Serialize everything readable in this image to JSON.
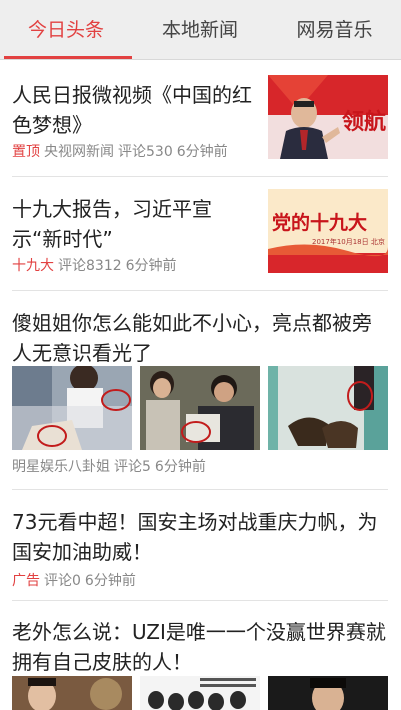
{
  "tabs": [
    {
      "label": "今日头条",
      "active": true
    },
    {
      "label": "本地新闻",
      "active": false
    },
    {
      "label": "网易音乐",
      "active": false
    }
  ],
  "news": [
    {
      "title": "人民日报微视频《中国的红色梦想》",
      "tag": "置顶",
      "source": "央视网新闻",
      "comments": "评论530",
      "time": "6分钟前",
      "thumb_text": "领航"
    },
    {
      "title": "十九大报告，习近平宣示“新时代”",
      "tag": "十九大",
      "source": "",
      "comments": "评论8312",
      "time": "6分钟前",
      "thumb_text": "党的十九大",
      "thumb_subtext": "2017年10月18日 北京"
    },
    {
      "title": "傻姐姐你怎么能如此不小心，亮点都被旁人无意识看光了",
      "tag": "",
      "source": "明星娱乐八卦姐",
      "comments": "评论5",
      "time": "6分钟前"
    },
    {
      "title": "73元看中超！国安主场对战重庆力帆，为国安加油助威！",
      "tag": "广告",
      "source": "",
      "comments": "评论0",
      "time": "6分钟前"
    },
    {
      "title": "老外怎么说：UZI是唯一一个没赢世界赛就拥有自己皮肤的人！",
      "tag": "",
      "source": "",
      "comments": "",
      "time": ""
    }
  ],
  "colors": {
    "accent": "#e24141",
    "tab_bg": "#eeeeee",
    "meta": "#888888"
  }
}
